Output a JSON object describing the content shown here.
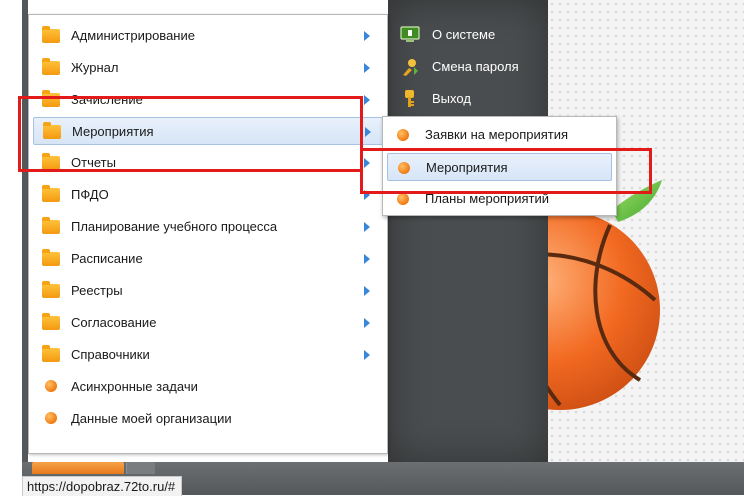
{
  "main_menu": {
    "items": [
      {
        "label": "Администрирование",
        "icon": "folder-icon",
        "has_submenu": true
      },
      {
        "label": "Журнал",
        "icon": "folder-icon",
        "has_submenu": true
      },
      {
        "label": "Зачисление",
        "icon": "folder-icon",
        "has_submenu": true
      },
      {
        "label": "Мероприятия",
        "icon": "folder-icon",
        "has_submenu": true,
        "active": true
      },
      {
        "label": "Отчеты",
        "icon": "folder-icon",
        "has_submenu": true
      },
      {
        "label": "ПФДО",
        "icon": "folder-icon",
        "has_submenu": true
      },
      {
        "label": "Планирование учебного процесса",
        "icon": "folder-icon",
        "has_submenu": true
      },
      {
        "label": "Расписание",
        "icon": "folder-icon",
        "has_submenu": true
      },
      {
        "label": "Реестры",
        "icon": "folder-icon",
        "has_submenu": true
      },
      {
        "label": "Согласование",
        "icon": "folder-icon",
        "has_submenu": true
      },
      {
        "label": "Справочники",
        "icon": "folder-icon",
        "has_submenu": true
      },
      {
        "label": "Асинхронные задачи",
        "icon": "orange-bullet-icon",
        "has_submenu": false
      },
      {
        "label": "Данные моей организации",
        "icon": "orange-bullet-icon",
        "has_submenu": false
      }
    ]
  },
  "system_menu": {
    "items": [
      {
        "label": "О системе",
        "icon": "monitor-info-icon"
      },
      {
        "label": "Смена пароля",
        "icon": "password-change-icon"
      },
      {
        "label": "Выход",
        "icon": "key-exit-icon"
      }
    ]
  },
  "submenu": {
    "items": [
      {
        "label": "Заявки на мероприятия",
        "icon": "orange-bullet-icon"
      },
      {
        "label": "Мероприятия",
        "icon": "orange-bullet-icon",
        "active": true
      },
      {
        "label": "Планы мероприятий",
        "icon": "orange-bullet-icon"
      }
    ]
  },
  "status_bar": {
    "url": "https://dopobraz.72to.ru/#"
  },
  "colors": {
    "accent_orange": "#f39a10",
    "highlight_red": "#e21a1a",
    "dark_panel": "#4a4d4f",
    "arrow_blue": "#3b86d8"
  }
}
